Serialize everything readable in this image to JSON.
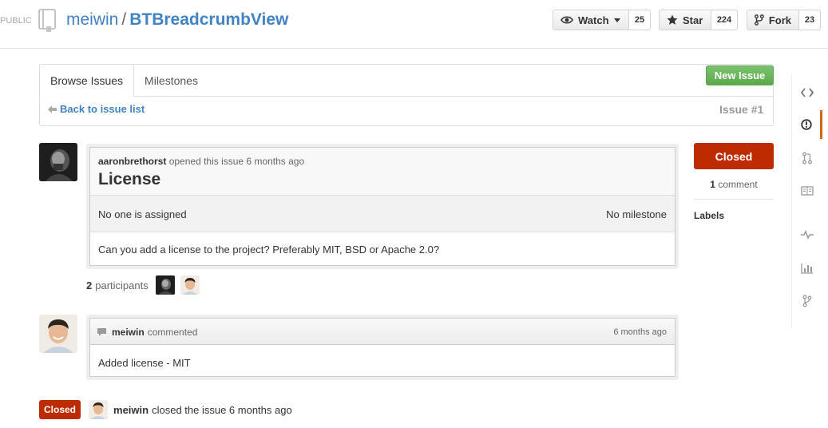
{
  "repo": {
    "visibility": "PUBLIC",
    "owner": "meiwin",
    "separator": "/",
    "name": "BTBreadcrumbView"
  },
  "actions": {
    "watch_label": "Watch",
    "watch_count": "25",
    "star_label": "Star",
    "star_count": "224",
    "fork_label": "Fork",
    "fork_count": "23"
  },
  "issues_nav": {
    "tabs": [
      {
        "label": "Browse Issues",
        "selected": true
      },
      {
        "label": "Milestones",
        "selected": false
      }
    ],
    "new_issue_label": "New Issue",
    "back_label": "Back to issue list",
    "issue_number": "Issue #1"
  },
  "issue": {
    "author": "aaronbrethorst",
    "opened_text": "opened this issue 6 months ago",
    "title": "License",
    "assignee_text": "No one is assigned",
    "milestone_text": "No milestone",
    "body": "Can you add a license to the project? Preferably MIT, BSD or Apache 2.0?",
    "participants_count": "2",
    "participants_label": "participants"
  },
  "comment": {
    "author": "meiwin",
    "action": "commented",
    "time": "6 months ago",
    "body": "Added license - MIT"
  },
  "event": {
    "badge": "Closed",
    "actor": "meiwin",
    "text": "closed the issue 6 months ago"
  },
  "sidebar": {
    "state": "Closed",
    "comment_count": "1",
    "comment_label": "comment",
    "labels_heading": "Labels"
  },
  "colors": {
    "link": "#4183c4",
    "closed": "#bd2c00",
    "new_issue": "#6cc644",
    "active_nav": "#d26911"
  }
}
